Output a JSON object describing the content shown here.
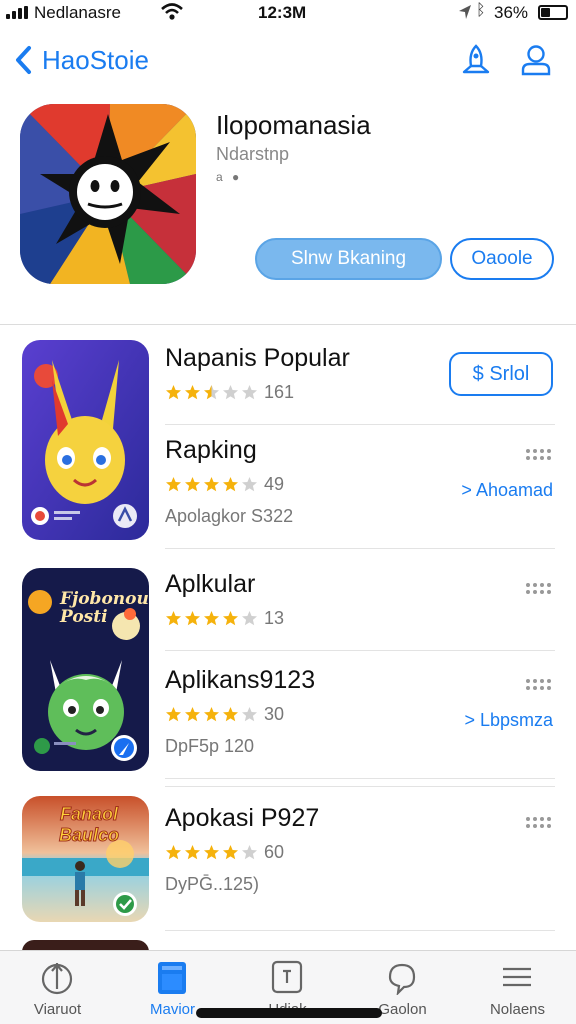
{
  "status_bar": {
    "carrier": "Nedlanasre",
    "time": "12:3M",
    "battery": "36%",
    "battery_fraction": 0.36
  },
  "nav": {
    "back_label": "HaoStoie",
    "icons": [
      "share-icon",
      "account-icon"
    ]
  },
  "app": {
    "title": "Ilopomanasia",
    "developer": "Ndarstnp",
    "meta": "a ●",
    "primary_button": "Slnw Bkaning",
    "secondary_button": "Oaoole"
  },
  "list": [
    {
      "title": "Napanis Popular",
      "rating": 2.5,
      "count": "161",
      "subtitle": "",
      "action_type": "price",
      "action": "$ Srlol"
    },
    {
      "title": "Rapking",
      "rating": 4,
      "count": "49",
      "subtitle": "Apolagkor S322",
      "action_type": "link",
      "action": "> Ahoamad"
    },
    {
      "title": "Aplkular",
      "rating": 4,
      "count": "13",
      "subtitle": "",
      "action_type": "more",
      "action": ""
    },
    {
      "title": "Aplikans9123",
      "rating": 4,
      "count": "30",
      "subtitle": "DpF5p 120",
      "action_type": "link",
      "action": "> Lbpsmza"
    },
    {
      "title": "Apokasi P927",
      "rating": 4,
      "count": "60",
      "subtitle": "DyPḠ..125)",
      "action_type": "more",
      "action": ""
    }
  ],
  "promo": {
    "title": "Fjobonoui Posti",
    "banner": "Fanaol Baulco"
  },
  "colors": {
    "accent": "#1a7cf0",
    "star": "#f5b20c",
    "star_empty": "#d0d0d0"
  },
  "tabs": [
    {
      "label": "Viaruot",
      "icon": "compass-icon",
      "active": false
    },
    {
      "label": "Mavior",
      "icon": "apps-icon",
      "active": true
    },
    {
      "label": "Hdiak",
      "icon": "games-icon",
      "active": false
    },
    {
      "label": "Gaolon",
      "icon": "chat-icon",
      "active": false
    },
    {
      "label": "Nolaens",
      "icon": "list-icon",
      "active": false
    }
  ]
}
